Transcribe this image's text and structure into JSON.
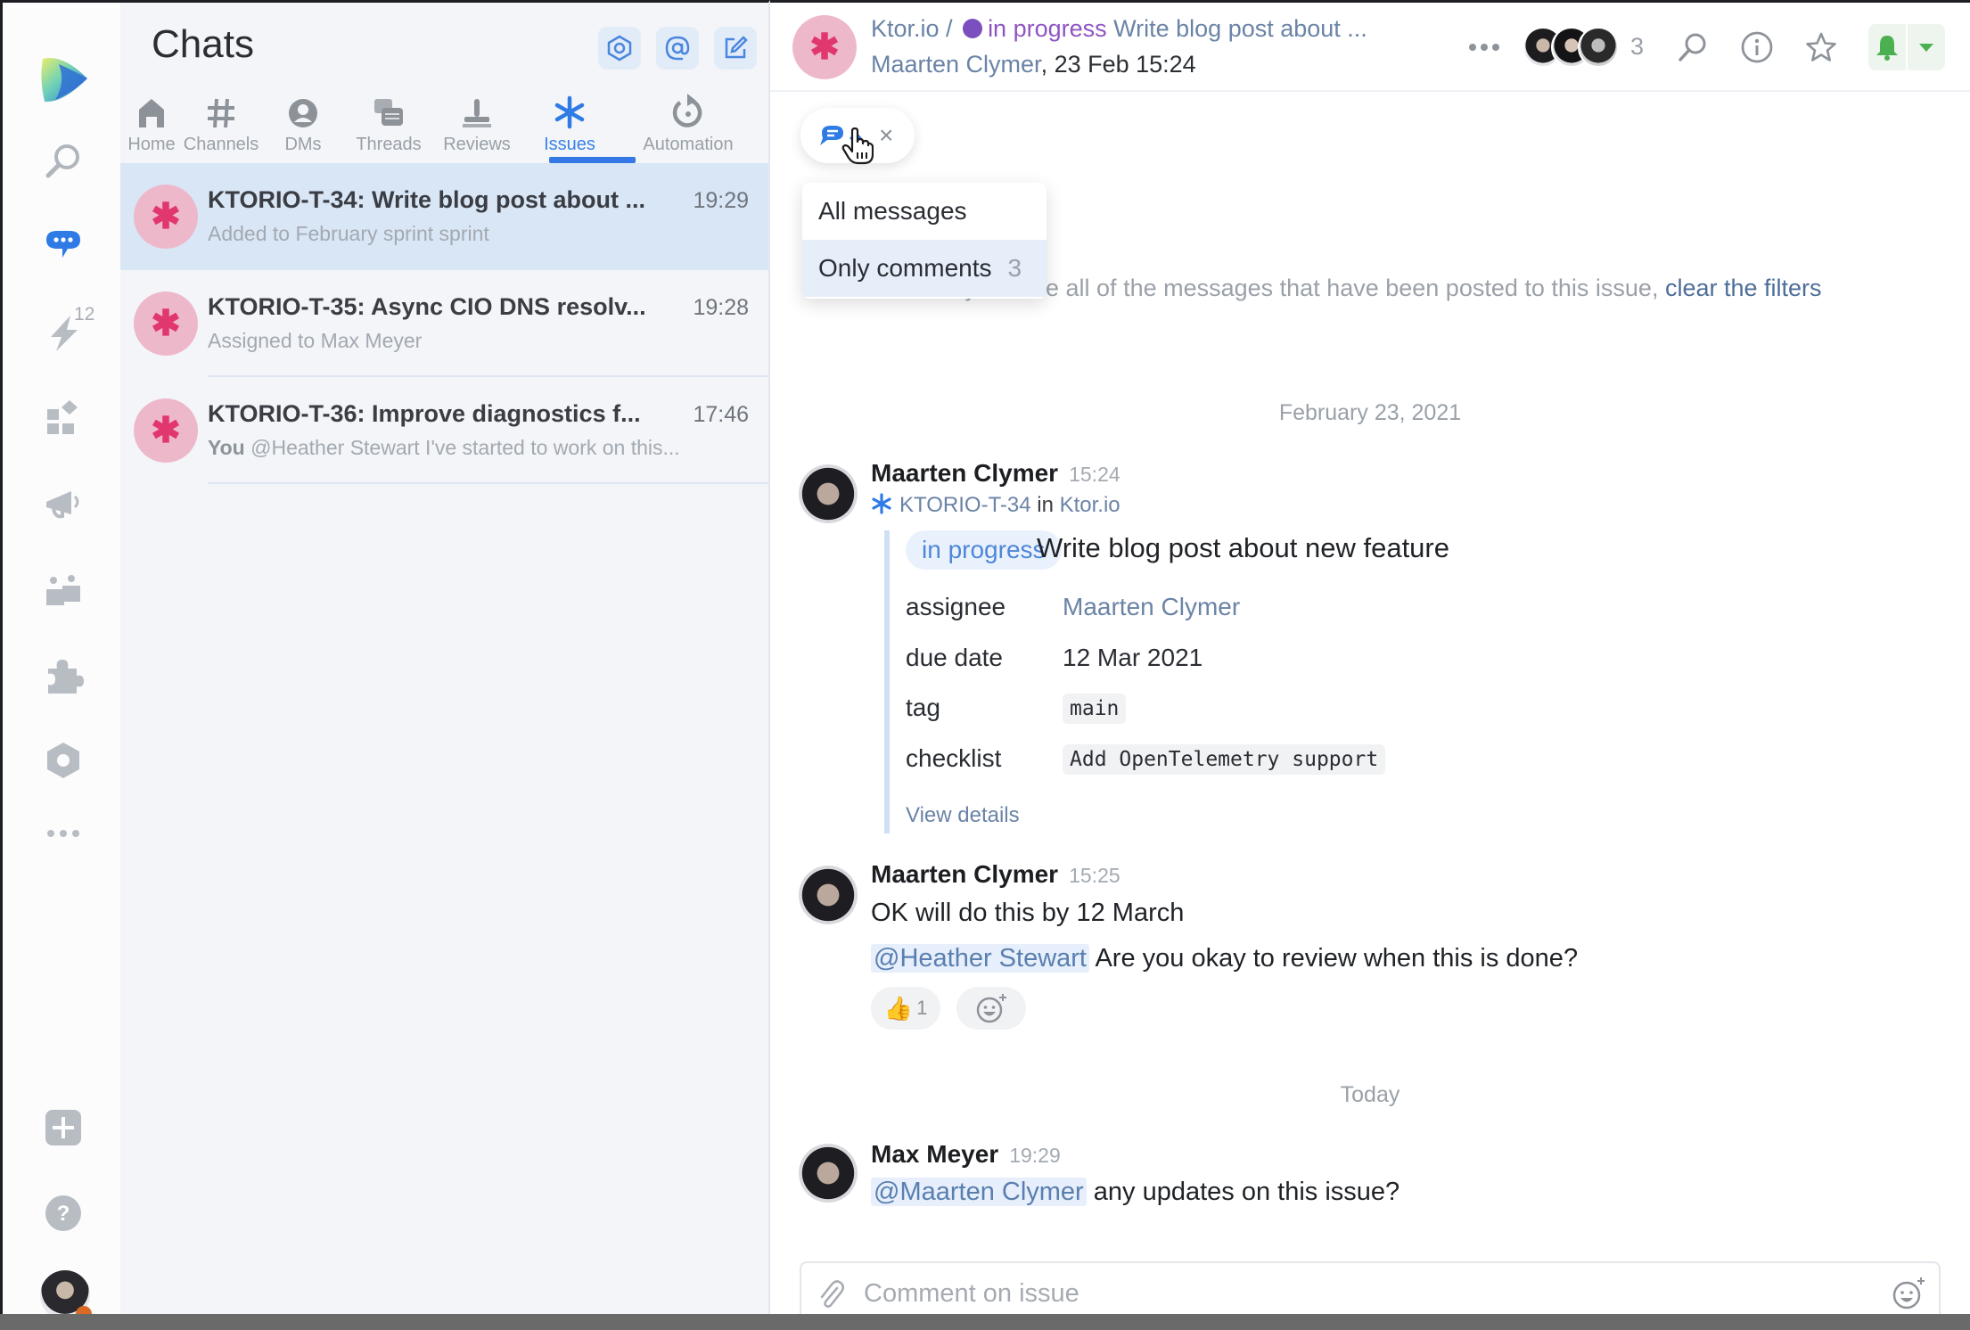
{
  "rail": {
    "items": [
      {
        "name": "logo",
        "icon": "space-logo"
      },
      {
        "name": "search",
        "icon": "search-icon"
      },
      {
        "name": "chats",
        "icon": "chat-bubble-icon",
        "active": true
      },
      {
        "name": "activity",
        "icon": "lightning-icon",
        "badge": "12"
      },
      {
        "name": "apps",
        "icon": "apps-grid-icon"
      },
      {
        "name": "announcements",
        "icon": "megaphone-icon"
      },
      {
        "name": "teams",
        "icon": "people-icon"
      },
      {
        "name": "extensions",
        "icon": "puzzle-icon"
      },
      {
        "name": "settings",
        "icon": "hexagon-gear-icon"
      },
      {
        "name": "more",
        "icon": "more-dots-icon"
      },
      {
        "name": "add",
        "icon": "plus-square-icon"
      },
      {
        "name": "help",
        "icon": "help-circle-icon"
      }
    ],
    "activity_badge": "12",
    "accent": "#2f7be5"
  },
  "chat_list": {
    "title": "Chats",
    "header_buttons": [
      "hexagon-settings-icon",
      "mention-at-icon",
      "compose-icon"
    ],
    "tabs": [
      {
        "label": "Home",
        "icon": "home-icon"
      },
      {
        "label": "Channels",
        "icon": "hash-icon"
      },
      {
        "label": "DMs",
        "icon": "person-circle-icon"
      },
      {
        "label": "Threads",
        "icon": "threads-icon"
      },
      {
        "label": "Reviews",
        "icon": "stamp-icon"
      },
      {
        "label": "Issues",
        "icon": "asterisk-icon",
        "active": true
      },
      {
        "label": "Automation",
        "icon": "refresh-icon"
      }
    ],
    "chats": [
      {
        "avatar_glyph": "✱",
        "title": "KTORIO-T-34: Write blog post about ...",
        "time": "19:29",
        "subtitle_prefix": "",
        "subtitle": "Added to February sprint sprint",
        "selected": true
      },
      {
        "avatar_glyph": "✱",
        "title": "KTORIO-T-35: Async CIO DNS resolv...",
        "time": "19:28",
        "subtitle_prefix": "",
        "subtitle": "Assigned to Max Meyer",
        "selected": false
      },
      {
        "avatar_glyph": "✱",
        "title": "KTORIO-T-36: Improve diagnostics f...",
        "time": "17:46",
        "subtitle_prefix": "You",
        "subtitle": " @Heather Stewart I've started to work on this...",
        "selected": false
      }
    ]
  },
  "header": {
    "avatar_glyph": "✱",
    "project": "Ktor.io",
    "separator": " / ",
    "status": "in progress",
    "status_color": "#7b4fc0",
    "title": " Write blog post about ...",
    "author": "Maarten Clymer",
    "date": ", 23 Feb 15:24",
    "member_count": "3",
    "bell_color": "#4caf50"
  },
  "filter": {
    "chip_icon": "comment-bubble-icon",
    "close_label": "×",
    "options": [
      {
        "label": "All messages",
        "count": "",
        "selected": false
      },
      {
        "label": "Only comments",
        "count": "3",
        "selected": true
      }
    ],
    "note_text": "…nly. To see all of the messages that have been posted to this issue, ",
    "note_link": "clear the filters"
  },
  "messages": {
    "date1": "February 23, 2021",
    "date2": "Today",
    "m1": {
      "author": "Maarten Clymer",
      "time": "15:24",
      "issue_key": "KTORIO-T-34",
      "in": " in ",
      "project": "Ktor.io",
      "status": "in progress",
      "title": "Write blog post about new feature",
      "fields": [
        {
          "label": "assignee",
          "value": "Maarten Clymer",
          "kind": "link"
        },
        {
          "label": "due date",
          "value": "12 Mar 2021",
          "kind": "text"
        },
        {
          "label": "tag",
          "value": "main",
          "kind": "code"
        },
        {
          "label": "checklist",
          "value": "Add OpenTelemetry support",
          "kind": "code"
        }
      ],
      "view_details": "View details"
    },
    "m2": {
      "author": "Maarten Clymer",
      "time": "15:25",
      "line1": "OK will do this by 12 March",
      "mention": "@Heather Stewart",
      "line2": " Are you okay to review when this is done?",
      "reaction_emoji": "👍",
      "reaction_count": "1"
    },
    "m3": {
      "author": "Max Meyer",
      "time": "19:29",
      "mention": "@Maarten Clymer",
      "text": " any updates on this issue?"
    }
  },
  "composer": {
    "placeholder": "Comment on issue",
    "value": ""
  }
}
